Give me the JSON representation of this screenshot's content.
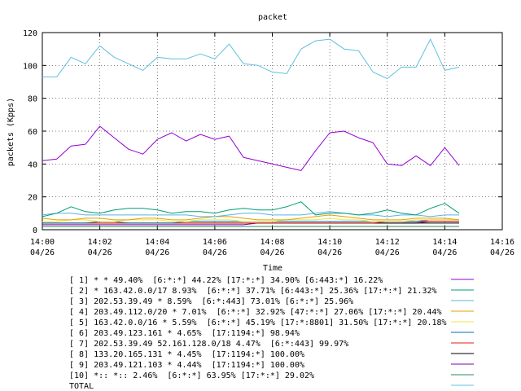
{
  "chart_data": {
    "type": "line",
    "title": "packet",
    "xlabel": "Time",
    "ylabel": "packets (Kpps)",
    "ylim": [
      0,
      120
    ],
    "y_ticks": [
      0,
      20,
      40,
      60,
      80,
      100,
      120
    ],
    "xlim": [
      "14:00",
      "14:16"
    ],
    "x_ticks": [
      {
        "time": "14:00",
        "date": "04/26"
      },
      {
        "time": "14:02",
        "date": "04/26"
      },
      {
        "time": "14:04",
        "date": "04/26"
      },
      {
        "time": "14:06",
        "date": "04/26"
      },
      {
        "time": "14:08",
        "date": "04/26"
      },
      {
        "time": "14:10",
        "date": "04/26"
      },
      {
        "time": "14:12",
        "date": "04/26"
      },
      {
        "time": "14:14",
        "date": "04/26"
      },
      {
        "time": "14:16",
        "date": "04/26"
      }
    ],
    "grid": true,
    "legend_placement": "bottom",
    "x": [
      "14:00:00",
      "14:00:30",
      "14:01:00",
      "14:01:30",
      "14:02:00",
      "14:02:30",
      "14:03:00",
      "14:03:30",
      "14:04:00",
      "14:04:30",
      "14:05:00",
      "14:05:30",
      "14:06:00",
      "14:06:30",
      "14:07:00",
      "14:07:30",
      "14:08:00",
      "14:08:30",
      "14:09:00",
      "14:09:30",
      "14:10:00",
      "14:10:30",
      "14:11:00",
      "14:11:30",
      "14:12:00",
      "14:12:30",
      "14:13:00",
      "14:13:30",
      "14:14:00",
      "14:14:30"
    ],
    "series": [
      {
        "name": "[ 1] * * 49.40%  [6:*:*] 44.22% [17:*:*] 34.90% [6:443:*] 16.22%",
        "color": "#9400d3",
        "values": [
          42,
          43,
          51,
          52,
          63,
          56,
          49,
          46,
          55,
          59,
          54,
          58,
          55,
          57,
          44,
          42,
          40,
          38,
          36,
          48,
          59,
          60,
          56,
          53,
          40,
          39,
          45,
          39,
          50,
          39,
          40
        ]
      },
      {
        "name": "[ 2] * 163.42.0.0/17 8.93%  [6:*:*] 37.71% [6:443:*] 25.36% [17:*:*] 21.32%",
        "color": "#009e73",
        "values": [
          8,
          10,
          14,
          11,
          10,
          12,
          13,
          13,
          12,
          10,
          11,
          11,
          10,
          12,
          13,
          12,
          12,
          14,
          17,
          9,
          10,
          10,
          9,
          10,
          12,
          10,
          9,
          13,
          16,
          10,
          10
        ]
      },
      {
        "name": "[ 3] 202.53.39.49 * 8.59%  [6:*:443] 73.01% [6:*:*] 25.96%",
        "color": "#56b4e9",
        "values": [
          9,
          10,
          10,
          9,
          9,
          9,
          9,
          9,
          9,
          9,
          9,
          8,
          8,
          9,
          10,
          10,
          9,
          9,
          9,
          10,
          11,
          10,
          9,
          9,
          8,
          9,
          9,
          8,
          9,
          9,
          8
        ]
      },
      {
        "name": "[ 4] 203.49.112.0/20 * 7.01%  [6:*:*] 32.92% [47:*:*] 27.06% [17:*:*] 20.44%",
        "color": "#e69f00",
        "values": [
          7,
          6,
          6,
          7,
          7,
          6,
          6,
          7,
          7,
          6,
          6,
          7,
          8,
          8,
          7,
          6,
          6,
          6,
          7,
          8,
          9,
          8,
          7,
          6,
          6,
          6,
          7,
          7,
          7,
          6,
          7
        ]
      },
      {
        "name": "[ 5] 163.42.0.0/16 * 5.59%  [6:*:*] 45.19% [17:*:8801] 31.50% [17:*:*] 20.18%",
        "color": "#f0e442",
        "values": [
          5,
          5,
          6,
          6,
          5,
          5,
          6,
          6,
          6,
          5,
          5,
          6,
          6,
          6,
          5,
          5,
          5,
          6,
          6,
          6,
          7,
          6,
          6,
          5,
          5,
          5,
          6,
          6,
          6,
          6,
          6
        ]
      },
      {
        "name": "[ 6] 203.49.123.161 * 4.65%  [17:1194:*] 98.94%",
        "color": "#0072b2",
        "values": [
          4,
          4,
          4,
          4,
          5,
          5,
          4,
          4,
          4,
          4,
          5,
          5,
          5,
          5,
          5,
          5,
          5,
          5,
          5,
          5,
          5,
          5,
          5,
          5,
          5,
          5,
          5,
          6,
          6,
          6,
          6
        ]
      },
      {
        "name": "[ 7] 202.53.39.49 52.161.128.0/18 4.47%  [6:*:443] 99.97%",
        "color": "#e51e10",
        "values": [
          4,
          4,
          4,
          4,
          4,
          4,
          4,
          4,
          4,
          4,
          4,
          4,
          4,
          4,
          4,
          4,
          4,
          4,
          4,
          4,
          4,
          4,
          4,
          4,
          5,
          5,
          5,
          5,
          5,
          5,
          5
        ]
      },
      {
        "name": "[ 8] 133.20.165.131 * 4.45%  [17:1194:*] 100.00%",
        "color": "#000000",
        "values": [
          4,
          4,
          4,
          4,
          4,
          4,
          4,
          4,
          4,
          4,
          4,
          4,
          4,
          4,
          4,
          4,
          4,
          4,
          4,
          4,
          4,
          4,
          4,
          4,
          4,
          4,
          4,
          4,
          4,
          4,
          4
        ]
      },
      {
        "name": "[ 9] 203.49.121.103 * 4.44%  [17:1194:*] 100.00%",
        "color": "#8000a0",
        "values": [
          3,
          3,
          3,
          3,
          3,
          3,
          3,
          3,
          3,
          3,
          3,
          3,
          3,
          3,
          3,
          4,
          4,
          4,
          4,
          4,
          4,
          4,
          4,
          4,
          4,
          4,
          4,
          5,
          5,
          5,
          5
        ]
      },
      {
        "name": "[10] *:: *:: 2.46%  [6:*:*] 63.95% [17:*:*] 29.02%",
        "color": "#2a8a55",
        "values": [
          2,
          2,
          2,
          2,
          2,
          2,
          2,
          2,
          2,
          2,
          2,
          2,
          2,
          2,
          2,
          2,
          2,
          2,
          2,
          2,
          2,
          2,
          2,
          2,
          2,
          2,
          2,
          2,
          2,
          2,
          2
        ]
      },
      {
        "name": "TOTAL",
        "color": "#5fc0e0",
        "values": [
          93,
          93,
          105,
          101,
          112,
          105,
          101,
          97,
          105,
          104,
          104,
          107,
          104,
          113,
          101,
          100,
          96,
          95,
          110,
          115,
          116,
          110,
          109,
          96,
          92,
          99,
          99,
          116,
          97,
          99,
          100
        ]
      }
    ]
  }
}
